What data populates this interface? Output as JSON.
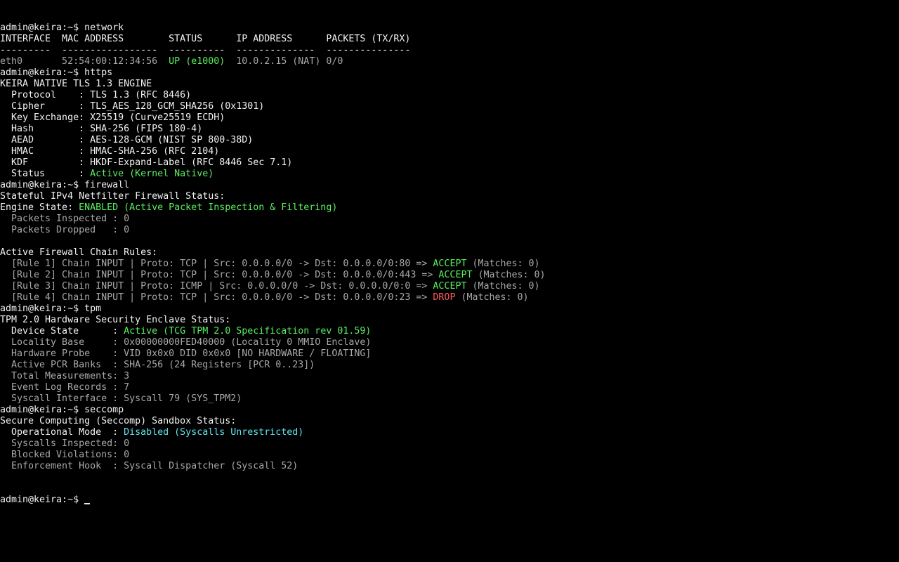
{
  "terminal": {
    "lines": [
      {
        "segments": [
          {
            "text": "admin@keira:~$ network",
            "color": "white"
          }
        ]
      },
      {
        "segments": [
          {
            "text": "INTERFACE  MAC ADDRESS        STATUS      IP ADDRESS      PACKETS (TX/RX)",
            "color": "white"
          }
        ]
      },
      {
        "segments": [
          {
            "text": "---------  -----------------  ----------  --------------  ---------------",
            "color": "white"
          }
        ]
      },
      {
        "segments": [
          {
            "text": "eth0       52:54:00:12:34:56  ",
            "color": "dim"
          },
          {
            "text": "UP (e1000)",
            "color": "green"
          },
          {
            "text": "  10.0.2.15 (NAT) 0/0",
            "color": "dim"
          }
        ]
      },
      {
        "segments": [
          {
            "text": "admin@keira:~$ https",
            "color": "white"
          }
        ]
      },
      {
        "segments": [
          {
            "text": "KEIRA NATIVE TLS 1.3 ENGINE",
            "color": "white"
          }
        ]
      },
      {
        "segments": [
          {
            "text": "  Protocol    : TLS 1.3 (RFC 8446)",
            "color": "white"
          }
        ]
      },
      {
        "segments": [
          {
            "text": "  Cipher      : TLS_AES_128_GCM_SHA256 (0x1301)",
            "color": "white"
          }
        ]
      },
      {
        "segments": [
          {
            "text": "  Key Exchange: X25519 (Curve25519 ECDH)",
            "color": "white"
          }
        ]
      },
      {
        "segments": [
          {
            "text": "  Hash        : SHA-256 (FIPS 180-4)",
            "color": "white"
          }
        ]
      },
      {
        "segments": [
          {
            "text": "  AEAD        : AES-128-GCM (NIST SP 800-38D)",
            "color": "white"
          }
        ]
      },
      {
        "segments": [
          {
            "text": "  HMAC        : HMAC-SHA-256 (RFC 2104)",
            "color": "white"
          }
        ]
      },
      {
        "segments": [
          {
            "text": "  KDF         : HKDF-Expand-Label (RFC 8446 Sec 7.1)",
            "color": "white"
          }
        ]
      },
      {
        "segments": [
          {
            "text": "  Status      : ",
            "color": "white"
          },
          {
            "text": "Active (Kernel Native)",
            "color": "green"
          }
        ]
      },
      {
        "segments": [
          {
            "text": "admin@keira:~$ firewall",
            "color": "white"
          }
        ]
      },
      {
        "segments": [
          {
            "text": "Stateful IPv4 Netfilter Firewall Status:",
            "color": "white"
          }
        ]
      },
      {
        "segments": [
          {
            "text": "Engine State: ",
            "color": "white"
          },
          {
            "text": "ENABLED (Active Packet Inspection & Filtering)",
            "color": "green"
          }
        ]
      },
      {
        "segments": [
          {
            "text": "  Packets Inspected : 0",
            "color": "dim"
          }
        ]
      },
      {
        "segments": [
          {
            "text": "  Packets Dropped   : 0",
            "color": "dim"
          }
        ]
      },
      {
        "segments": [
          {
            "text": "",
            "color": "white"
          }
        ]
      },
      {
        "segments": [
          {
            "text": "Active Firewall Chain Rules:",
            "color": "white"
          }
        ]
      },
      {
        "segments": [
          {
            "text": "  [Rule 1] Chain INPUT | Proto: TCP | Src: 0.0.0.0/0 -> Dst: 0.0.0.0/0:80 => ",
            "color": "dim"
          },
          {
            "text": "ACCEPT",
            "color": "green"
          },
          {
            "text": " (Matches: 0)",
            "color": "dim"
          }
        ]
      },
      {
        "segments": [
          {
            "text": "  [Rule 2] Chain INPUT | Proto: TCP | Src: 0.0.0.0/0 -> Dst: 0.0.0.0/0:443 => ",
            "color": "dim"
          },
          {
            "text": "ACCEPT",
            "color": "green"
          },
          {
            "text": " (Matches: 0)",
            "color": "dim"
          }
        ]
      },
      {
        "segments": [
          {
            "text": "  [Rule 3] Chain INPUT | Proto: ICMP | Src: 0.0.0.0/0 -> Dst: 0.0.0.0/0:0 => ",
            "color": "dim"
          },
          {
            "text": "ACCEPT",
            "color": "green"
          },
          {
            "text": " (Matches: 0)",
            "color": "dim"
          }
        ]
      },
      {
        "segments": [
          {
            "text": "  [Rule 4] Chain INPUT | Proto: TCP | Src: 0.0.0.0/0 -> Dst: 0.0.0.0/0:23 => ",
            "color": "dim"
          },
          {
            "text": "DROP",
            "color": "red"
          },
          {
            "text": " (Matches: 0)",
            "color": "dim"
          }
        ]
      },
      {
        "segments": [
          {
            "text": "admin@keira:~$ tpm",
            "color": "white"
          }
        ]
      },
      {
        "segments": [
          {
            "text": "TPM 2.0 Hardware Security Enclave Status:",
            "color": "white"
          }
        ]
      },
      {
        "segments": [
          {
            "text": "  Device State      : ",
            "color": "white"
          },
          {
            "text": "Active (TCG TPM 2.0 Specification rev 01.59)",
            "color": "green"
          }
        ]
      },
      {
        "segments": [
          {
            "text": "  Locality Base     : 0x00000000FED40000 (Locality 0 MMIO Enclave)",
            "color": "dim"
          }
        ]
      },
      {
        "segments": [
          {
            "text": "  Hardware Probe    : VID 0x0x0 DID 0x0x0 [NO HARDWARE / FLOATING]",
            "color": "dim"
          }
        ]
      },
      {
        "segments": [
          {
            "text": "  Active PCR Banks  : SHA-256 (24 Registers [PCR 0..23])",
            "color": "dim"
          }
        ]
      },
      {
        "segments": [
          {
            "text": "  Total Measurements: 3",
            "color": "dim"
          }
        ]
      },
      {
        "segments": [
          {
            "text": "  Event Log Records : 7",
            "color": "dim"
          }
        ]
      },
      {
        "segments": [
          {
            "text": "  Syscall Interface : Syscall 79 (SYS_TPM2)",
            "color": "dim"
          }
        ]
      },
      {
        "segments": [
          {
            "text": "admin@keira:~$ seccomp",
            "color": "white"
          }
        ]
      },
      {
        "segments": [
          {
            "text": "Secure Computing (Seccomp) Sandbox Status:",
            "color": "white"
          }
        ]
      },
      {
        "segments": [
          {
            "text": "  Operational Mode  : ",
            "color": "white"
          },
          {
            "text": "Disabled (Syscalls Unrestricted)",
            "color": "cyan"
          }
        ]
      },
      {
        "segments": [
          {
            "text": "  Syscalls Inspected: 0",
            "color": "dim"
          }
        ]
      },
      {
        "segments": [
          {
            "text": "  Blocked Violations: 0",
            "color": "dim"
          }
        ]
      },
      {
        "segments": [
          {
            "text": "  Enforcement Hook  : Syscall Dispatcher (Syscall 52)",
            "color": "dim"
          }
        ]
      }
    ],
    "prompt": "admin@keira:~$ "
  },
  "colors": {
    "background": "#000000",
    "white": "#f2f2f2",
    "dim": "#a8a8a8",
    "green": "#58f05e",
    "red": "#ff5c5c",
    "cyan": "#5ee6f0"
  }
}
